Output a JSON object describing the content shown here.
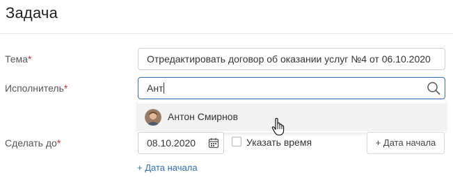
{
  "header": {
    "title": "Задача"
  },
  "form": {
    "topic": {
      "label": "Тема",
      "required_mark": "*",
      "value": "Отредактировать договор об оказании услуг №4 от 06.10.2020"
    },
    "assignee": {
      "label": "Исполнитель",
      "required_mark": "*",
      "value": "Ант",
      "suggestions": [
        {
          "name": "Антон Смирнов"
        }
      ]
    },
    "due": {
      "label": "Сделать до",
      "required_mark": "*",
      "date": "08.10.2020",
      "time_checkbox_label": "Указать время",
      "time_checked": false,
      "add_start_button": "+ Дата начала",
      "add_start_link": "+ Дата начала"
    }
  },
  "colors": {
    "accent": "#2f6fb6",
    "required": "#d0313b",
    "hover_bg": "#f2f2f2"
  },
  "icons": {
    "search": "search-icon",
    "calendar": "calendar-icon",
    "cursor": "hand-pointer-icon",
    "avatar": "user-avatar"
  }
}
